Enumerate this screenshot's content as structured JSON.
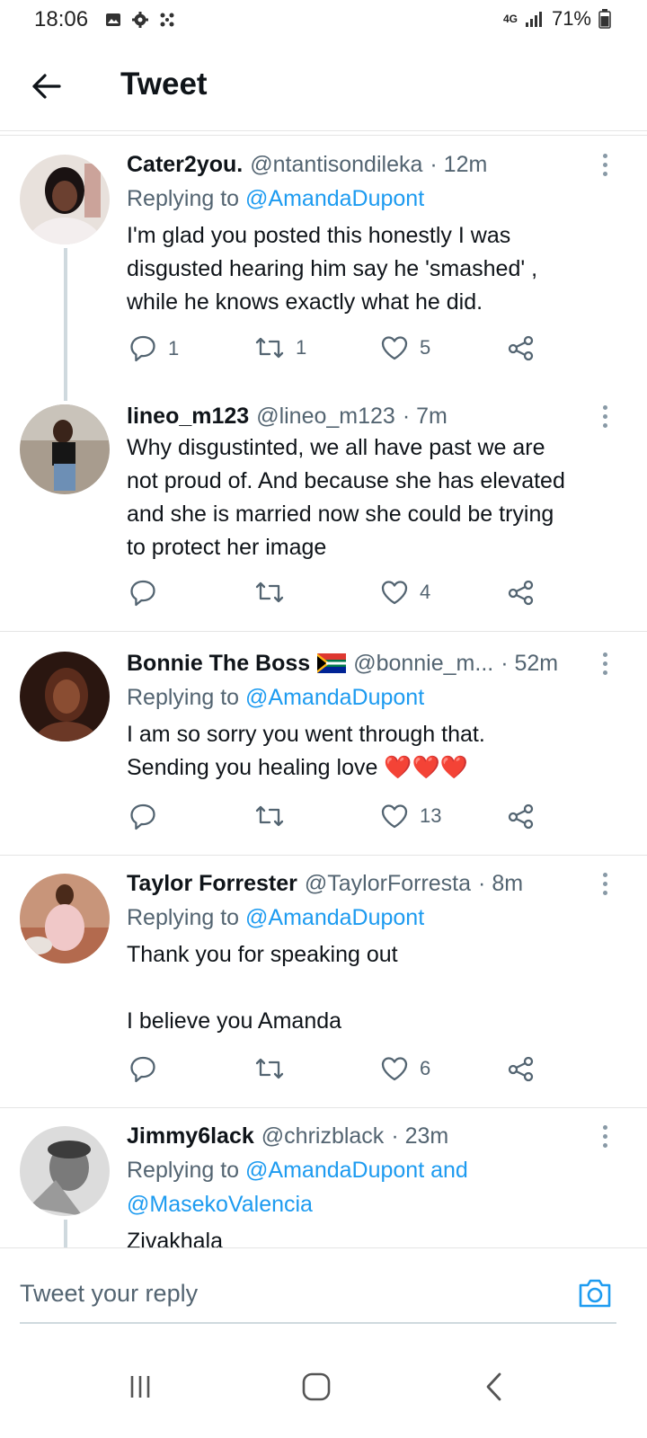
{
  "status_bar": {
    "time": "18:06",
    "network": "4G",
    "battery": "71%"
  },
  "header": {
    "title": "Tweet"
  },
  "replies": [
    {
      "name": "Cater2you.",
      "handle": "@ntantisondileka",
      "time": "· 12m",
      "replying_prefix": "Replying to ",
      "replying_to": "@AmandaDupont",
      "text": "I'm glad you posted this honestly I was\ndisgusted hearing him say he 'smashed' ,\nwhile he knows exactly what he did.",
      "reply_count": "1",
      "retweet_count": "1",
      "like_count": "5"
    },
    {
      "name": "lineo_m123",
      "handle": "@lineo_m123",
      "time": "· 7m",
      "text": "Why disgustinted, we all have past we are\nnot proud of. And because she has elevated\nand she is married now she could be trying\nto protect her image",
      "reply_count": "",
      "retweet_count": "",
      "like_count": "4"
    },
    {
      "name": "Bonnie The Boss",
      "handle": "@bonnie_m...",
      "time": "· 52m",
      "replying_prefix": "Replying to ",
      "replying_to": "@AmandaDupont",
      "text": "I am so sorry you went through that.\nSending you healing love ",
      "emoji_text": "❤️❤️❤️",
      "reply_count": "",
      "retweet_count": "",
      "like_count": "13"
    },
    {
      "name": "Taylor Forrester",
      "handle": "@TaylorForresta",
      "time": "· 8m",
      "replying_prefix": "Replying to ",
      "replying_to": "@AmandaDupont",
      "text": "Thank you for speaking out\n\nI believe you Amanda",
      "reply_count": "",
      "retweet_count": "",
      "like_count": "6"
    },
    {
      "name": "Jimmy6lack",
      "handle": "@chrizblack",
      "time": "· 23m",
      "replying_prefix": "Replying to ",
      "replying_to": "@AmandaDupont and",
      "replying_to_2": "@MasekoValencia",
      "text": "Zivakhala"
    }
  ],
  "reply_bar": {
    "placeholder": "Tweet your reply"
  },
  "icons": {
    "back": "arrow-left-icon",
    "more": "more-vertical-icon",
    "reply": "comment-icon",
    "retweet": "retweet-icon",
    "like": "heart-icon",
    "share": "share-icon",
    "camera": "camera-icon",
    "flag": "south-africa-flag-icon"
  },
  "colors": {
    "accent": "#1d9bf0",
    "secondary_text": "#536471",
    "divider": "#e5e5e5"
  }
}
